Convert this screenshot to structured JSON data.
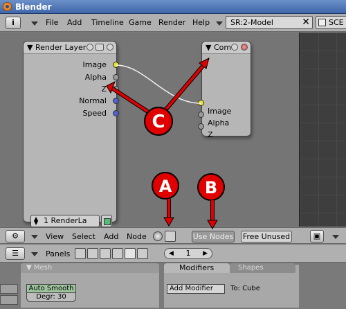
{
  "window": {
    "title": "Blender"
  },
  "menubar": {
    "items": [
      "File",
      "Add",
      "Timeline",
      "Game",
      "Render",
      "Help"
    ],
    "screen_field": "SR:2-Model",
    "scene_field": "SCE"
  },
  "node_render_layer": {
    "title": "Render Layer",
    "outputs": [
      "Image",
      "Alpha",
      "Z",
      "Normal",
      "Speed"
    ],
    "layer_select": "1 RenderLa"
  },
  "node_composite": {
    "title": "Com",
    "inputs": [
      "Image",
      "Alpha",
      "Z"
    ]
  },
  "node_header": {
    "menus": [
      "View",
      "Select",
      "Add",
      "Node"
    ],
    "use_nodes": "Use Nodes",
    "free_unused": "Free Unused"
  },
  "panels_header": {
    "label": "Panels",
    "page": "1"
  },
  "mesh_panel": {
    "tab": "Mesh",
    "auto_smooth": "Auto Smooth",
    "degree": "Degr: 30"
  },
  "modifiers_panel": {
    "tab_modifiers": "Modifiers",
    "tab_shapes": "Shapes",
    "add_modifier": "Add Modifier",
    "to_object": "To: Cube"
  },
  "annotations": {
    "a": "A",
    "b": "B",
    "c": "C",
    "color": "#e00000"
  },
  "colors": {
    "socket_yellow": "#e5e52a",
    "socket_blue": "#5060d0",
    "socket_gray": "#9a9a9a",
    "title_bar": "#3f67a8"
  }
}
